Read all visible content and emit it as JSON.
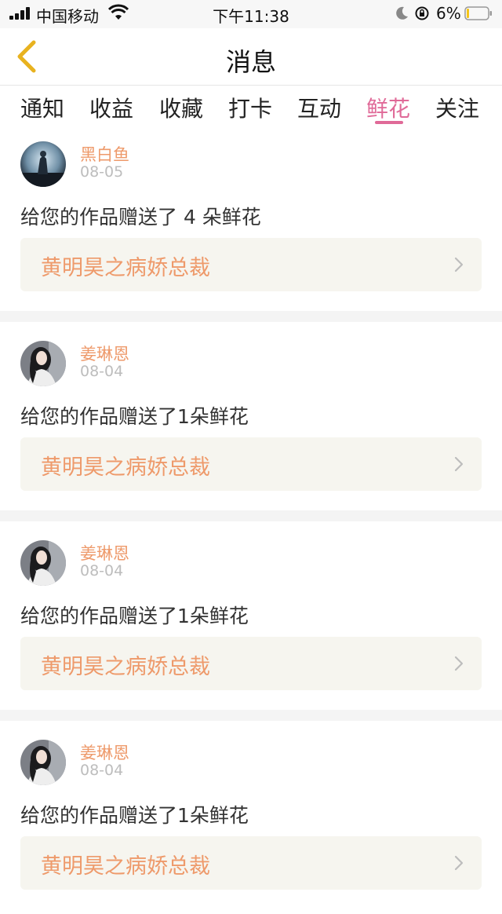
{
  "status_bar": {
    "carrier": "中国移动",
    "time": "下午11:38",
    "battery": "6%"
  },
  "nav": {
    "title": "消息",
    "back_icon": "chevron-left-icon",
    "back_color": "#e8b21f"
  },
  "tabs": [
    {
      "label": "通知",
      "active": false
    },
    {
      "label": "收益",
      "active": false
    },
    {
      "label": "收藏",
      "active": false
    },
    {
      "label": "打卡",
      "active": false
    },
    {
      "label": "互动",
      "active": false
    },
    {
      "label": "鲜花",
      "active": true
    },
    {
      "label": "关注",
      "active": false
    }
  ],
  "colors": {
    "accent": "#e06a98",
    "name": "#ee9a6b",
    "link_bg": "#f6f5ef"
  },
  "messages": [
    {
      "username": "黑白鱼",
      "date": "08-05",
      "text": "给您的作品赠送了 4 朵鲜花",
      "work_title": "黄明昊之病娇总裁"
    },
    {
      "username": "姜琳恩",
      "date": "08-04",
      "text": "给您的作品赠送了1朵鲜花",
      "work_title": "黄明昊之病娇总裁"
    },
    {
      "username": "姜琳恩",
      "date": "08-04",
      "text": "给您的作品赠送了1朵鲜花",
      "work_title": "黄明昊之病娇总裁"
    },
    {
      "username": "姜琳恩",
      "date": "08-04",
      "text": "给您的作品赠送了1朵鲜花",
      "work_title": "黄明昊之病娇总裁"
    }
  ]
}
